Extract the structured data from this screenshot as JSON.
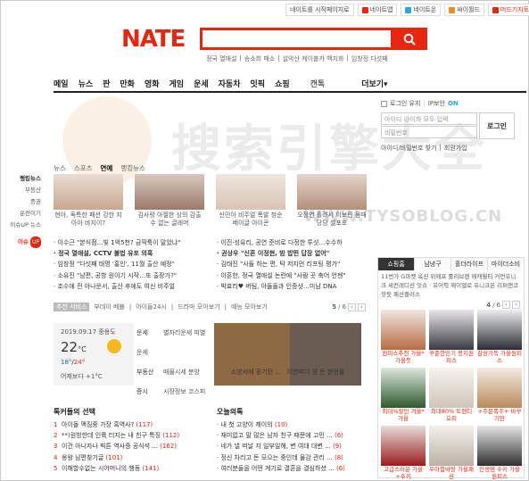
{
  "top_links": [
    {
      "label": "네이트를 시작페이지로",
      "icon": "none",
      "color": "#ffffff"
    },
    {
      "label": "네이트앱",
      "icon": "nateapp-icon",
      "color": "#e8260f"
    },
    {
      "label": "네이트온",
      "icon": "nateon-icon",
      "color": "#2aa7e2"
    },
    {
      "label": "싸이월드",
      "icon": "cyworld-icon",
      "color": "#f28a1f"
    },
    {
      "label": "머드기지토",
      "icon": "mud-icon",
      "color": "#e8260f"
    }
  ],
  "logo": "NATE",
  "search": {
    "placeholder": "",
    "keywords": [
      "정국 열애설",
      "송소희 패소",
      "설악산 케이블카 백지화",
      "임창정 다섯째"
    ]
  },
  "nav": [
    "메일",
    "뉴스",
    "판",
    "만화",
    "영화",
    "게임",
    "운세",
    "자동차",
    "잇픽",
    "쇼핑",
    "캔톡",
    "더보기"
  ],
  "login": {
    "keep": "로그인 유지",
    "ip": "IP보안",
    "ip_state": "ON",
    "id_ph": "아이디 @이하 모두 입력",
    "pw_ph": "비밀번호",
    "btn": "로그인",
    "find": "아이디/비밀번호 찾기",
    "join": "회원가입"
  },
  "watermark": {
    "text": "搜索引擎大全",
    "url": "WWW.TYSOBLOG.CN"
  },
  "sidebar": [
    "랭킹뉴스",
    "부동산",
    "증권",
    "운전이기",
    "이슈UP 뉴스",
    "이슈"
  ],
  "sidebar_badge": "UP",
  "news_tabs": [
    "뉴스",
    "스포츠",
    "연예",
    "랭킹뉴스"
  ],
  "news_active": "연예",
  "thumbs": [
    {
      "caption": "현아, 독특한 패션 강한 지아아 바지이?",
      "color": "#c9a88e"
    },
    {
      "caption": "김사랑 아찔한 상의 감출 수 없는 글래머",
      "color": "#9b7a6a"
    },
    {
      "caption": "신민아 비주얼 폭발 청순 베이글 아이콘",
      "color": "#d9c4b6"
    },
    {
      "caption": "오정연 홀려서 이보린 몸매 당당 셀포포",
      "color": "#b38f78"
    }
  ],
  "headlines_left": [
    "이수근 \"본식점…빛 1억5천? 금딱툭이 말았냐\"",
    "정국 열애설, CCTV 불법 유포 의혹",
    "임창정 \"다섯째 태명 '홍인', 11월 출산 예정\"",
    "소유진 \"남편, 공항 원이기 시작…또 출장가?\"",
    "조수애 전 아나운서, 출산 후에도 여신 비주얼"
  ],
  "headlines_right": [
    "이진·성유리, 공연 준비로 다정한 투샷…수수하",
    "권상우 \"신흔 이정현, 밤 밥떤 답장 없어\"",
    "김태진 \"사들 하는 편, 탁 저지먼 리프팅 평가\"",
    "이혼한, 정국 열애설 논란에 \"사람 곳 축어 언젠\"",
    "박효리♥ 버팀, 아들들과 인증샷…미남 DNA"
  ],
  "svc_bar": {
    "label": "추천 서비스",
    "items": [
      "부데이 베뷸",
      "아이들24시",
      "드라마 모아보기",
      "예능 모아보기"
    ],
    "page": "5",
    "total": "6"
  },
  "weather": {
    "date": "2019.09.17",
    "place": "종용도",
    "temp": "22",
    "unit": "°C",
    "low": "18°",
    "high": "24°",
    "desc": "어제보다",
    "diff": "+1°C"
  },
  "weather_sun_color": "#f7b81d",
  "side_info": [
    {
      "label": "운세",
      "value": "별자리운세 띠별운세"
    },
    {
      "label": "부동산",
      "value": "매물시세 분양"
    },
    {
      "label": "증시",
      "value": "시장정보 코스피"
    }
  ],
  "food_caption": "소방서에 둥기된 ...",
  "food_caption2": "이연피디 땅 든 한인들",
  "section_left": {
    "title": "톡커들의 선택",
    "items": [
      {
        "text": "아이돌 맥짐중 가장 흑역사?",
        "count": "(117)"
      },
      {
        "text": "**)원빙한데 인륙 터지는 내 친구 특징",
        "count": "(112)"
      },
      {
        "text": "이건 아니자나 빅튼 역사증 공식석 ...",
        "count": "(162)"
      },
      {
        "text": "옹왕 남편찾기글",
        "count": "(101)"
      },
      {
        "text": "이해할수없는 시어머니의 행동",
        "count": "(141)"
      }
    ]
  },
  "section_right": {
    "title": "오늘의톡",
    "items": [
      {
        "text": "내 첫 고양이 제이의",
        "count": "(10)"
      },
      {
        "text": "재미없고 말 많은 남자 친구 때문에 고민 ...",
        "count": "(6)"
      },
      {
        "text": "네가 낼 떠날 지 일부일해, 변 여대 대변 ...",
        "count": "(9)"
      },
      {
        "text": "정신 차리고 돈 모으는 중인데 물감 관리 ...",
        "count": "(8)"
      },
      {
        "text": "여러분들을 어떤 게기로 결혼을 결심하셨 ...",
        "count": "(6)"
      }
    ]
  },
  "shopping": {
    "tabs": [
      "쇼핑홈",
      "남녕구",
      "홀더라이프",
      "마이더소비"
    ],
    "cats": "11번가 G마켓 옥션 위메프 롤리브랜 매캐월티 커먼유니크 세컨레디션 잇슈 · 유어픽 제이델로 유니크온 리퍼앤코 핫핏 패션플러스",
    "page": "4",
    "total": "6",
    "products": [
      {
        "caption": "원피스추천 가을*가을듯",
        "color": "#b76b43"
      },
      {
        "caption": "꾸준한인기 봉지원피스",
        "color": "#3a3a44"
      },
      {
        "caption": "감성가득 가을원피스",
        "color": "#2b2b35"
      },
      {
        "caption": "최대%할인 겨울*가을",
        "color": "#2e5a2e"
      },
      {
        "caption": "최대80% 트렌디오피",
        "color": "#e8e2d8"
      },
      {
        "caption": "+주문폭주+ 바꾸기만",
        "color": "#b98b5a"
      },
      {
        "caption": "고급스러운 가을+수키",
        "color": "#9a1d1d"
      },
      {
        "caption": "우아함바탕 가을패션",
        "color": "#d8d2c6"
      },
      {
        "caption": "인생템 수키 가을원피스",
        "color": "#303030"
      }
    ]
  },
  "accent": "#e8260f"
}
